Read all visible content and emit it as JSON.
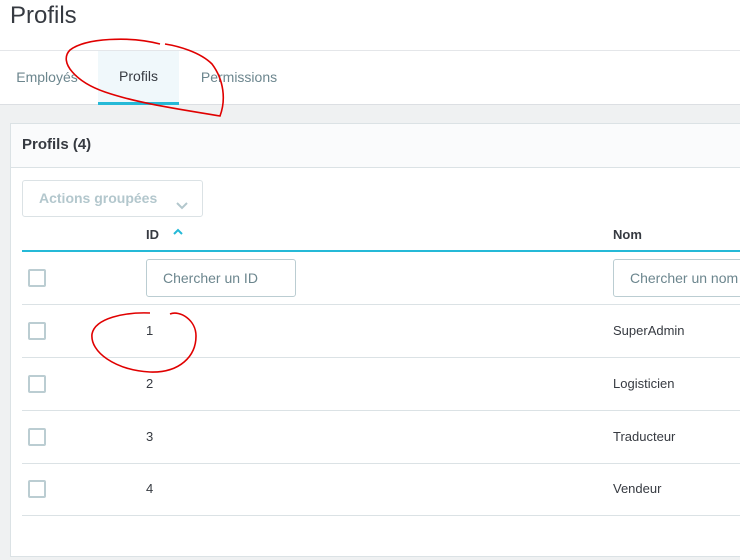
{
  "header": {
    "title": "Profils"
  },
  "tabs": [
    {
      "label": "Employés",
      "active": false
    },
    {
      "label": "Profils",
      "active": true
    },
    {
      "label": "Permissions",
      "active": false
    }
  ],
  "panel": {
    "title": "Profils (4)",
    "bulk_actions_label": "Actions groupées",
    "columns": {
      "id": "ID",
      "name": "Nom"
    },
    "sort": {
      "column": "ID",
      "direction": "ascending"
    },
    "filters": {
      "id_placeholder": "Chercher un ID",
      "name_placeholder": "Chercher un nom"
    },
    "rows": [
      {
        "id": "1",
        "name": "SuperAdmin"
      },
      {
        "id": "2",
        "name": "Logisticien"
      },
      {
        "id": "3",
        "name": "Traducteur"
      },
      {
        "id": "4",
        "name": "Vendeur"
      }
    ]
  },
  "colors": {
    "accent": "#25b9d7",
    "annotation": "#e00000",
    "text": "#363a41",
    "muted": "#6c868e"
  },
  "icons": {
    "sort": "caret-up-icon",
    "dropdown": "chevron-down-icon"
  }
}
